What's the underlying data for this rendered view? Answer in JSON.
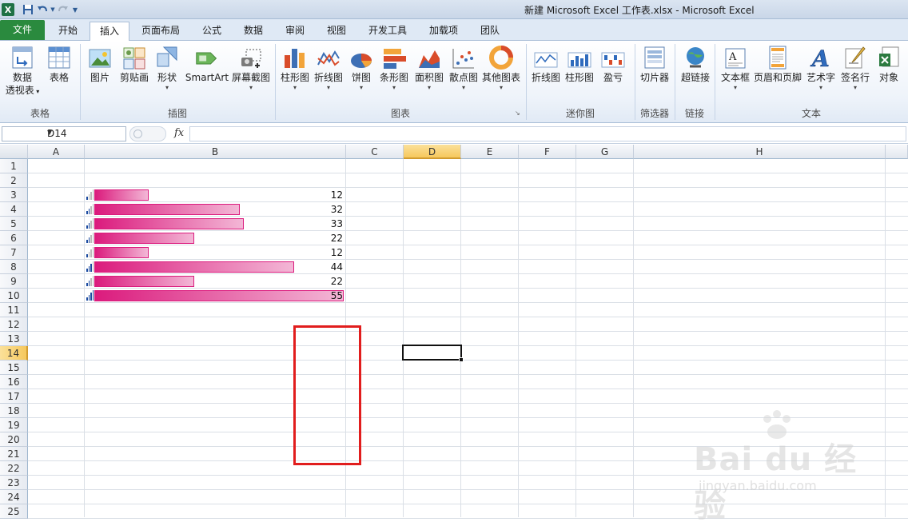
{
  "window": {
    "title": "新建 Microsoft Excel 工作表.xlsx  -  Microsoft Excel",
    "app_logo": "X",
    "qat_icons": [
      "save-icon",
      "undo-icon",
      "redo-icon",
      "customize-icon"
    ]
  },
  "tabs": [
    {
      "label": "文件",
      "kind": "file"
    },
    {
      "label": "开始"
    },
    {
      "label": "插入",
      "active": true
    },
    {
      "label": "页面布局"
    },
    {
      "label": "公式"
    },
    {
      "label": "数据"
    },
    {
      "label": "审阅"
    },
    {
      "label": "视图"
    },
    {
      "label": "开发工具"
    },
    {
      "label": "加载项"
    },
    {
      "label": "团队"
    }
  ],
  "ribbon": {
    "groups": [
      "表格",
      "插图",
      "图表",
      "迷你图",
      "筛选器",
      "链接",
      "文本"
    ],
    "buttons": [
      {
        "label": "数据",
        "label2": "透视表",
        "icon": "pivot-table-icon"
      },
      {
        "label": "表格",
        "icon": "table-icon"
      },
      {
        "label": "图片",
        "icon": "picture-icon"
      },
      {
        "label": "剪贴画",
        "icon": "clipart-icon"
      },
      {
        "label": "形状",
        "icon": "shapes-icon"
      },
      {
        "label": "SmartArt",
        "icon": "smartart-icon"
      },
      {
        "label": "屏幕截图",
        "icon": "screenshot-icon"
      },
      {
        "label": "柱形图",
        "icon": "column-chart-icon"
      },
      {
        "label": "折线图",
        "icon": "line-chart-icon"
      },
      {
        "label": "饼图",
        "icon": "pie-chart-icon"
      },
      {
        "label": "条形图",
        "icon": "bar-chart-icon"
      },
      {
        "label": "面积图",
        "icon": "area-chart-icon"
      },
      {
        "label": "散点图",
        "icon": "scatter-chart-icon"
      },
      {
        "label": "其他图表",
        "icon": "other-charts-icon"
      },
      {
        "label": "折线图",
        "icon": "sparkline-line-icon"
      },
      {
        "label": "柱形图",
        "icon": "sparkline-column-icon"
      },
      {
        "label": "盈亏",
        "icon": "sparkline-winloss-icon"
      },
      {
        "label": "切片器",
        "icon": "slicer-icon"
      },
      {
        "label": "超链接",
        "icon": "hyperlink-icon"
      },
      {
        "label": "文本框",
        "icon": "textbox-icon"
      },
      {
        "label": "页眉和页脚",
        "icon": "header-footer-icon"
      },
      {
        "label": "艺术字",
        "icon": "wordart-icon"
      },
      {
        "label": "签名行",
        "icon": "signature-line-icon"
      },
      {
        "label": "对象",
        "icon": "object-icon"
      }
    ]
  },
  "formula_bar": {
    "name_box": "D14",
    "fx": "fx",
    "formula": ""
  },
  "sheet": {
    "columns": [
      "A",
      "B",
      "C",
      "D",
      "E",
      "F",
      "G",
      "H"
    ],
    "selected_column": "D",
    "rows": [
      "1",
      "2",
      "3",
      "4",
      "5",
      "6",
      "7",
      "8",
      "9",
      "10",
      "11",
      "12",
      "13",
      "14",
      "15",
      "16",
      "17",
      "18",
      "19",
      "20",
      "21",
      "22",
      "23",
      "24",
      "25"
    ],
    "selected_row": "14",
    "selected_cell": "D14",
    "values": [
      {
        "row": "3",
        "value": "12",
        "fraction": 0.218
      },
      {
        "row": "4",
        "value": "32",
        "fraction": 0.582
      },
      {
        "row": "5",
        "value": "33",
        "fraction": 0.6
      },
      {
        "row": "6",
        "value": "22",
        "fraction": 0.4
      },
      {
        "row": "7",
        "value": "12",
        "fraction": 0.218
      },
      {
        "row": "8",
        "value": "44",
        "fraction": 0.8
      },
      {
        "row": "9",
        "value": "22",
        "fraction": 0.4
      },
      {
        "row": "10",
        "value": "55",
        "fraction": 1.0
      }
    ],
    "bar_color": "#db1b7d",
    "highlight_color": "#e11d1d"
  },
  "watermark": {
    "line1": "Bai du 经验",
    "line2": "jingyan.baidu.com"
  }
}
